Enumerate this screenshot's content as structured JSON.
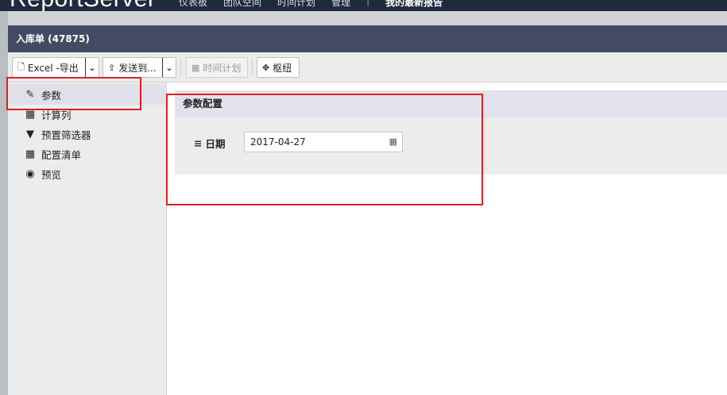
{
  "app": {
    "brand_light": "Report",
    "brand_bold": "Server"
  },
  "topnav": {
    "items": [
      "仪表板",
      "团队空间",
      "时间计划",
      "管理"
    ],
    "active": "我的最新报告"
  },
  "panel": {
    "title": "入库单 (47875)"
  },
  "toolbar": {
    "excel_label": "Excel -导出",
    "send_label": "发送到...",
    "schedule_label": "时间计划",
    "pivot_label": "枢纽"
  },
  "sidebar": {
    "items": [
      {
        "label": "参数",
        "icon": "edit-icon"
      },
      {
        "label": "计算列",
        "icon": "table-icon"
      },
      {
        "label": "预置筛选器",
        "icon": "filter-icon"
      },
      {
        "label": "配置清单",
        "icon": "table-edit-icon"
      },
      {
        "label": "预览",
        "icon": "eye-icon"
      }
    ],
    "selected": 0
  },
  "params": {
    "section_title": "参数配置",
    "date_label": "日期",
    "date_value": "2017-04-27"
  }
}
